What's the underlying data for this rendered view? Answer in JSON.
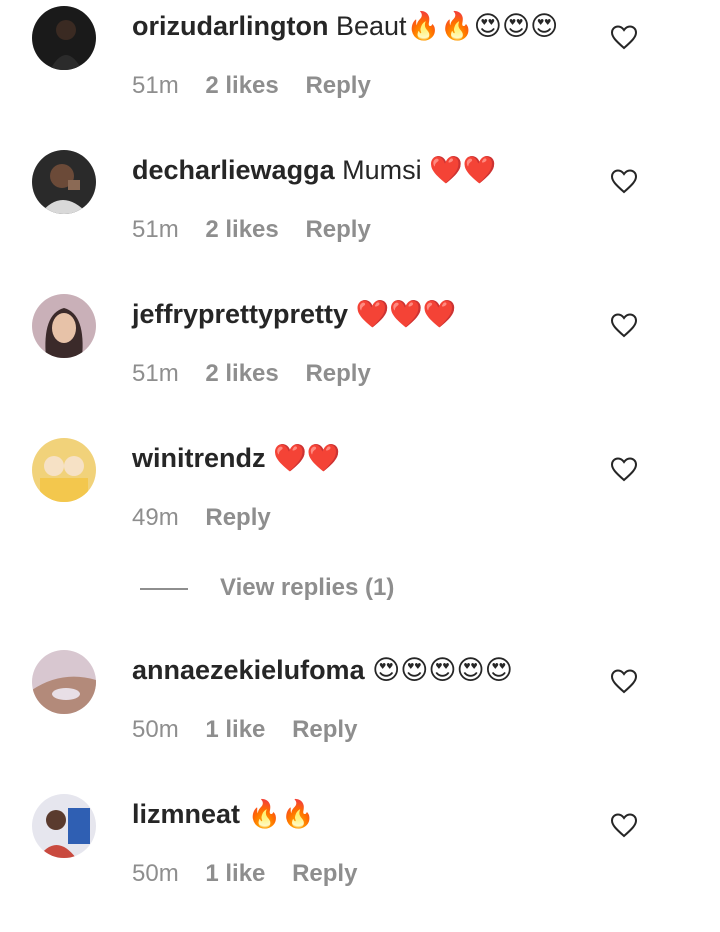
{
  "colors": {
    "text": "#262626",
    "muted": "#8e8e8e",
    "background": "#ffffff"
  },
  "comments": [
    {
      "username": "orizudarlington",
      "text": "Beaut🔥🔥😍😍😍",
      "time": "51m",
      "likes": "2 likes",
      "reply": "Reply",
      "icon": "heart-outline-icon"
    },
    {
      "username": "decharliewagga",
      "text": "Mumsi ❤️❤️",
      "time": "51m",
      "likes": "2 likes",
      "reply": "Reply",
      "icon": "heart-outline-icon"
    },
    {
      "username": "jeffryprettypretty",
      "text": "❤️❤️❤️",
      "time": "51m",
      "likes": "2 likes",
      "reply": "Reply",
      "icon": "heart-outline-icon"
    },
    {
      "username": "winitrendz",
      "text": "❤️❤️",
      "time": "49m",
      "likes": "",
      "reply": "Reply",
      "icon": "heart-outline-icon"
    },
    {
      "username": "annaezekielufoma",
      "text": "😍😍😍😍😍",
      "time": "50m",
      "likes": "1 like",
      "reply": "Reply",
      "icon": "heart-outline-icon"
    },
    {
      "username": "lizmneat",
      "text": "🔥🔥",
      "time": "50m",
      "likes": "1 like",
      "reply": "Reply",
      "icon": "heart-outline-icon"
    }
  ],
  "view_replies": {
    "label": "View replies (1)"
  }
}
